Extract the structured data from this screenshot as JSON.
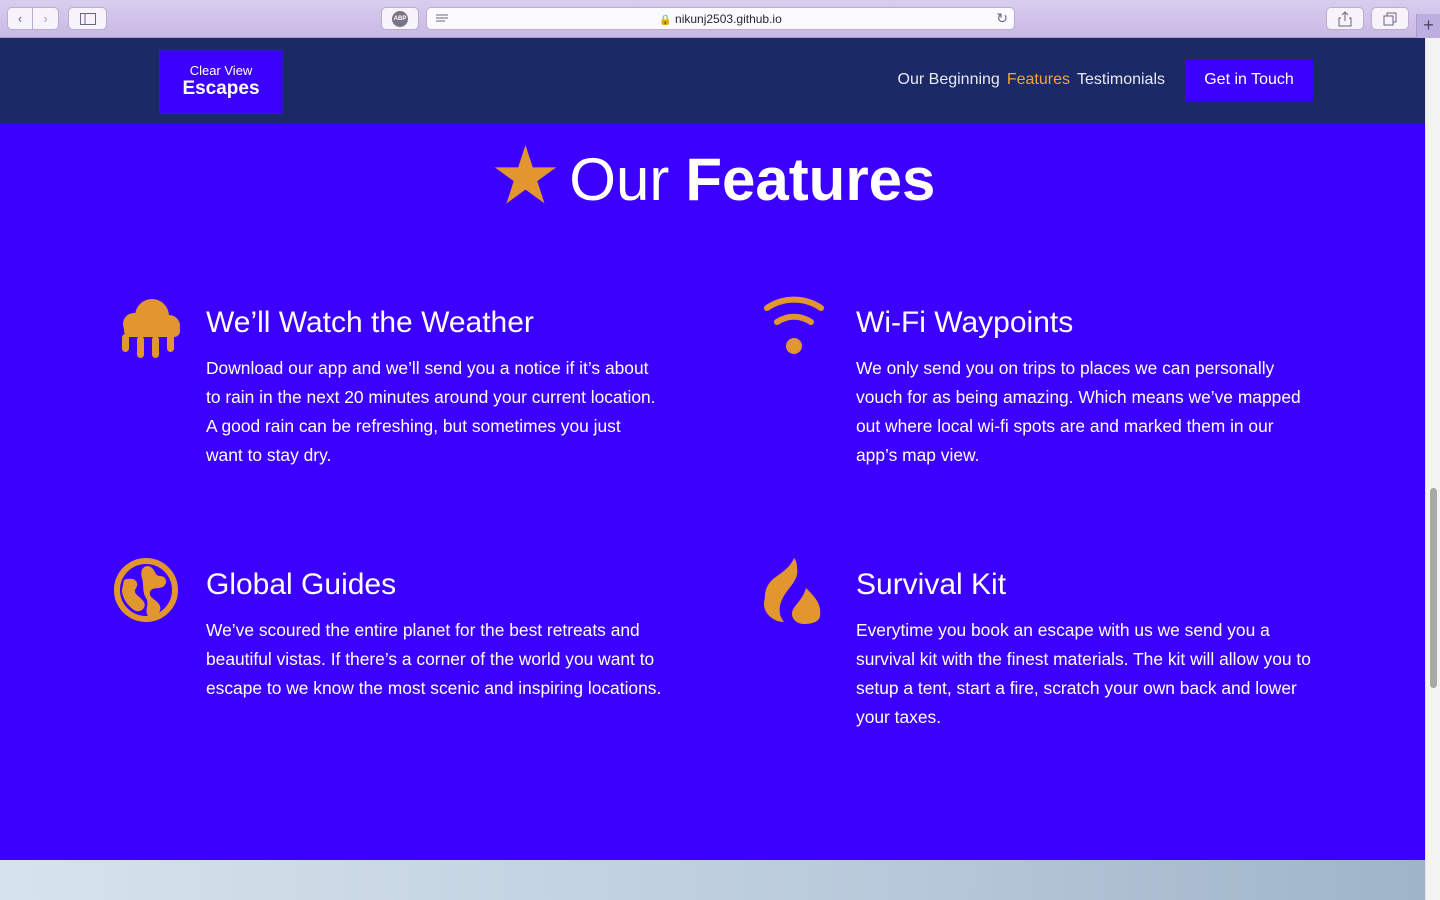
{
  "browser": {
    "url": "nikunj2503.github.io",
    "extension_label": "ABP",
    "new_tab": "+"
  },
  "header": {
    "logo_line1": "Clear View",
    "logo_line2": "Escapes",
    "nav": [
      "Our Beginning",
      "Features",
      "Testimonials"
    ],
    "active_nav": "Features",
    "cta": "Get in Touch"
  },
  "features_section": {
    "title_light": "Our",
    "title_bold": "Features",
    "items": [
      {
        "icon": "cloud-rain-icon",
        "title": "We’ll Watch the Weather",
        "text": "Download our app and we’ll send you a notice if it’s about to rain in the next 20 minutes around your current location. A good rain can be refreshing, but sometimes you just want to stay dry."
      },
      {
        "icon": "wifi-icon",
        "title": "Wi-Fi Waypoints",
        "text": "We only send you on trips to places we can personally vouch for as being amazing. Which means we’ve mapped out where local wi-fi spots are and marked them in our app’s map view."
      },
      {
        "icon": "globe-icon",
        "title": "Global Guides",
        "text": "We’ve scoured the entire planet for the best retreats and beautiful vistas. If there’s a corner of the world you want to escape to we know the most scenic and inspiring locations."
      },
      {
        "icon": "fire-icon",
        "title": "Survival Kit",
        "text": "Everytime you book an escape with us we send you a survival kit with the finest materials. The kit will allow you to setup a tent, start a fire, scratch your own back and lower your taxes."
      }
    ]
  },
  "colors": {
    "header_bg": "#1b2a66",
    "brand_blue": "#3c00ff",
    "accent_orange": "#e2962e"
  }
}
